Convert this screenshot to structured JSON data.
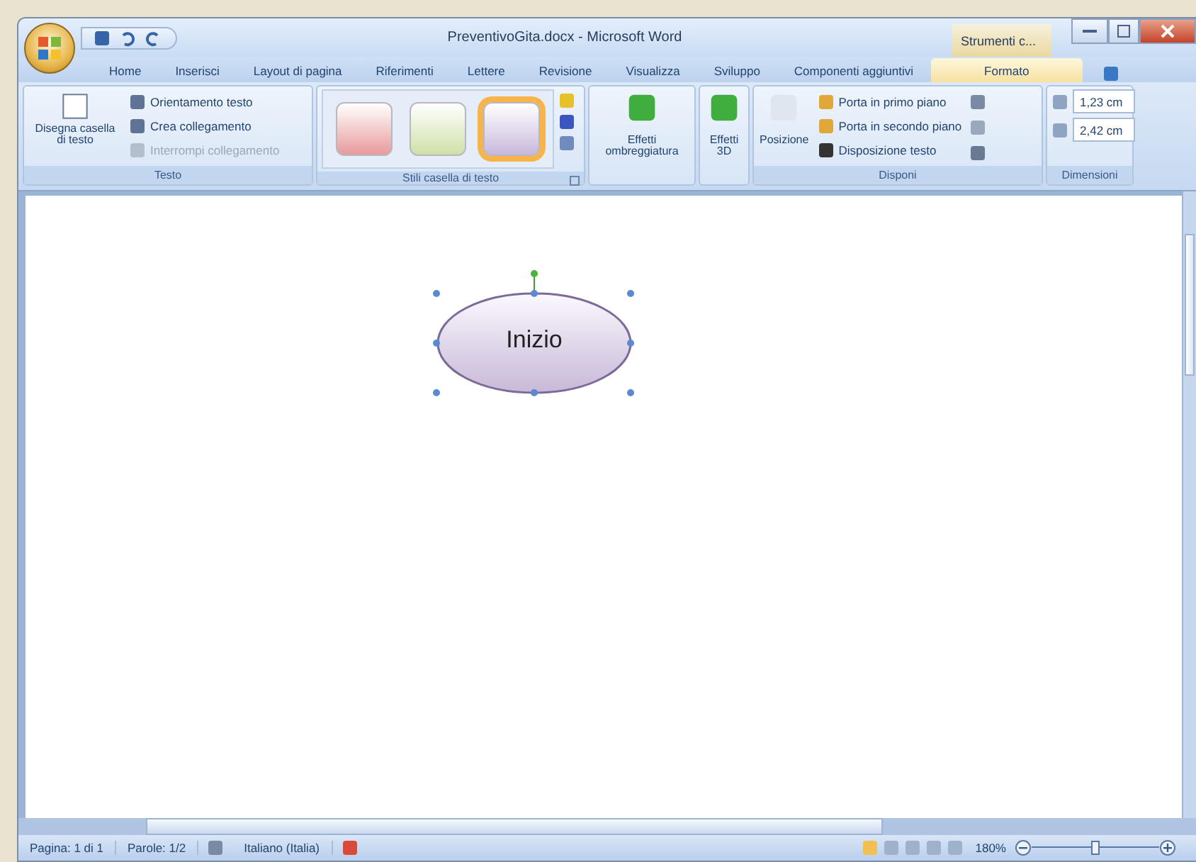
{
  "window": {
    "title": "PreventivoGita.docx - Microsoft Word",
    "contextual_tab": "Strumenti c..."
  },
  "tabs": [
    {
      "label": "Home",
      "selected": false
    },
    {
      "label": "Inserisci",
      "selected": false
    },
    {
      "label": "Layout di pagina",
      "selected": false
    },
    {
      "label": "Riferimenti",
      "selected": false
    },
    {
      "label": "Lettere",
      "selected": false
    },
    {
      "label": "Revisione",
      "selected": false
    },
    {
      "label": "Visualizza",
      "selected": false
    },
    {
      "label": "Sviluppo",
      "selected": false
    },
    {
      "label": "Componenti aggiuntivi",
      "selected": false
    },
    {
      "label": "Formato",
      "selected": true
    }
  ],
  "ribbon": {
    "testo": {
      "label": "Testo",
      "large_button": "Disegna casella di testo",
      "items": [
        {
          "label": "Orientamento testo",
          "disabled": false
        },
        {
          "label": "Crea collegamento",
          "disabled": false
        },
        {
          "label": "Interrompi collegamento",
          "disabled": true
        }
      ]
    },
    "styles": {
      "label": "Stili casella di testo",
      "items": [
        {
          "color": "#e89a9a",
          "selected": false
        },
        {
          "color": "#cfe0a8",
          "selected": false
        },
        {
          "color": "#c8b8dc",
          "selected": true
        }
      ]
    },
    "shadow": {
      "label": "Effetti ombreggiatura"
    },
    "effects3d": {
      "label": "Effetti 3D"
    },
    "disponi": {
      "label": "Disponi",
      "position": "Posizione",
      "items": [
        "Porta in primo piano",
        "Porta in secondo piano",
        "Disposizione testo"
      ]
    },
    "dimensioni": {
      "label": "Dimensioni",
      "height": "1,23 cm",
      "width": "2,42 cm"
    }
  },
  "document": {
    "shape": {
      "text": "Inizio",
      "selected": true
    }
  },
  "status_bar": {
    "page": "Pagina: 1 di 1",
    "words": "Parole: 1/2",
    "language": "Italiano (Italia)",
    "zoom": "180%",
    "zoom_slider": {
      "level": 0.5
    }
  }
}
